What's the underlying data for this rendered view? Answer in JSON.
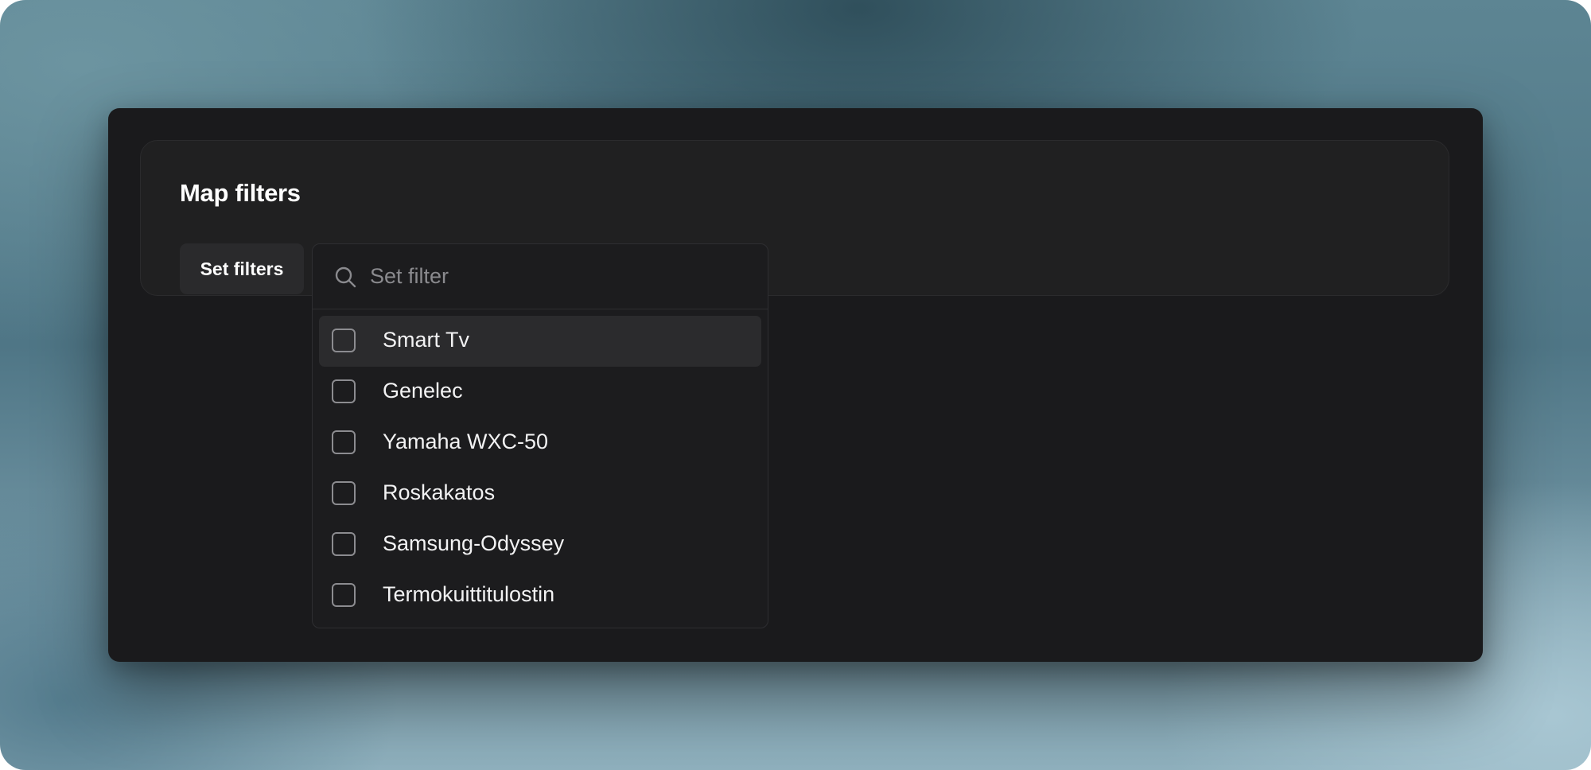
{
  "card": {
    "title": "Map filters",
    "set_filters_label": "Set filters"
  },
  "dropdown": {
    "search_placeholder": "Set filter",
    "search_value": "",
    "highlighted_index": 0,
    "options": [
      {
        "label": "Smart Tv",
        "checked": false
      },
      {
        "label": "Genelec",
        "checked": false
      },
      {
        "label": "Yamaha WXC-50",
        "checked": false
      },
      {
        "label": "Roskakatos",
        "checked": false
      },
      {
        "label": "Samsung-Odyssey",
        "checked": false
      },
      {
        "label": "Termokuittitulostin",
        "checked": false
      }
    ]
  },
  "colors": {
    "window_bg": "#1a1a1c",
    "card_bg": "#202021",
    "highlight_bg": "#2b2b2d",
    "checkbox_border": "#8c8c90"
  },
  "icons": {
    "search": "search-icon"
  }
}
